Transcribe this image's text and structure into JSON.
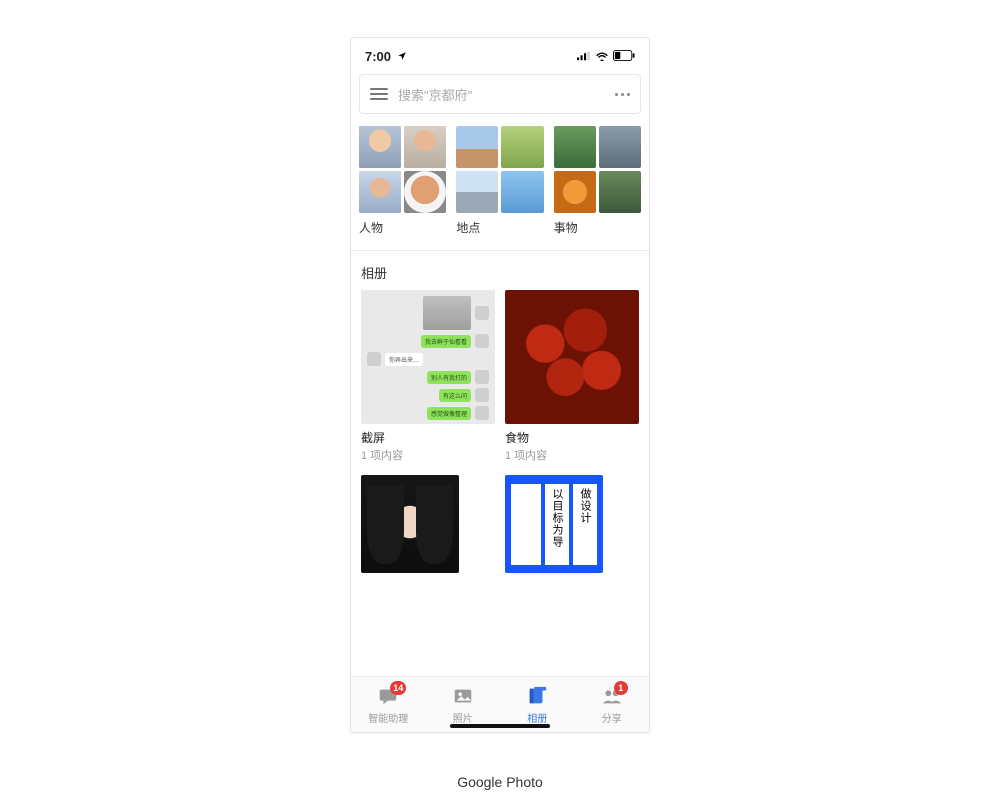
{
  "caption": "Google Photo",
  "statusbar": {
    "time": "7:00"
  },
  "search": {
    "placeholder": "搜索\"京都府\""
  },
  "categories": [
    {
      "label": "人物"
    },
    {
      "label": "地点"
    },
    {
      "label": "事物"
    }
  ],
  "albums_section_title": "相册",
  "albums": [
    {
      "name": "截屏",
      "count": "1 项内容",
      "chat_bubbles": [
        "你弄出来…",
        "我去鲜于仙看看",
        "别人有我打的",
        "有这么问",
        "感觉做像整理"
      ]
    },
    {
      "name": "食物",
      "count": "1 项内容"
    }
  ],
  "banner_lines": [
    "以目标为导",
    "做设计"
  ],
  "tabs": [
    {
      "label": "智能助理",
      "badge": "14"
    },
    {
      "label": "照片"
    },
    {
      "label": "相册",
      "active": true
    },
    {
      "label": "分享",
      "badge": "1"
    }
  ]
}
